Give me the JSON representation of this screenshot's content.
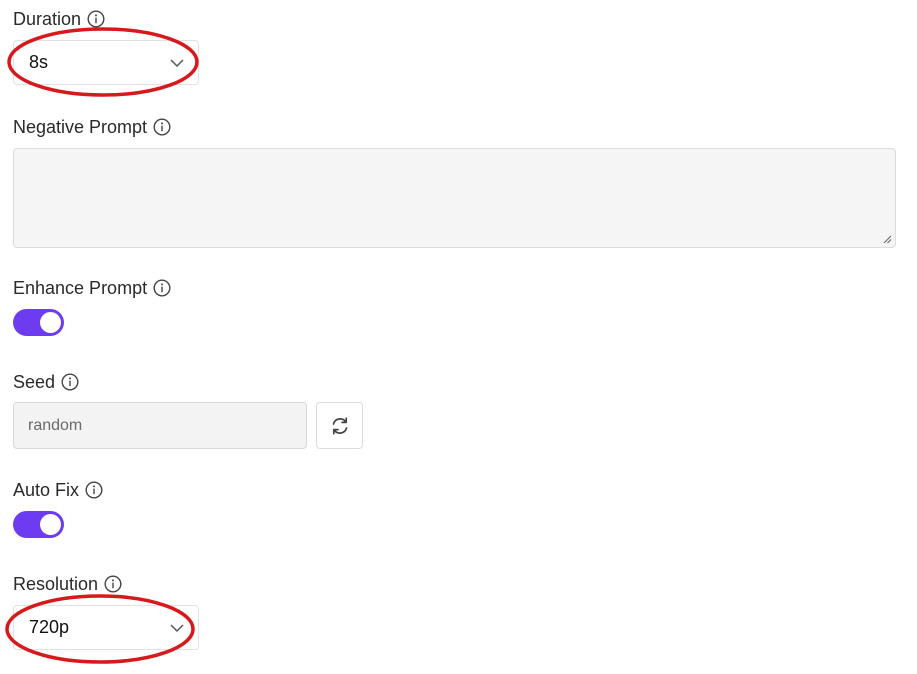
{
  "duration": {
    "label": "Duration",
    "info_icon": "info-icon",
    "selected_value": "8s"
  },
  "negative_prompt": {
    "label": "Negative Prompt",
    "info_icon": "info-icon",
    "value": ""
  },
  "enhance_prompt": {
    "label": "Enhance Prompt",
    "info_icon": "info-icon",
    "enabled": true
  },
  "seed": {
    "label": "Seed",
    "info_icon": "info-icon",
    "placeholder": "random",
    "refresh_icon": "refresh-icon"
  },
  "auto_fix": {
    "label": "Auto Fix",
    "info_icon": "info-icon",
    "enabled": true
  },
  "resolution": {
    "label": "Resolution",
    "info_icon": "info-icon",
    "selected_value": "720p"
  },
  "colors": {
    "toggle_on": "#6e3cf0",
    "annotation_circle": "#d7191c"
  }
}
